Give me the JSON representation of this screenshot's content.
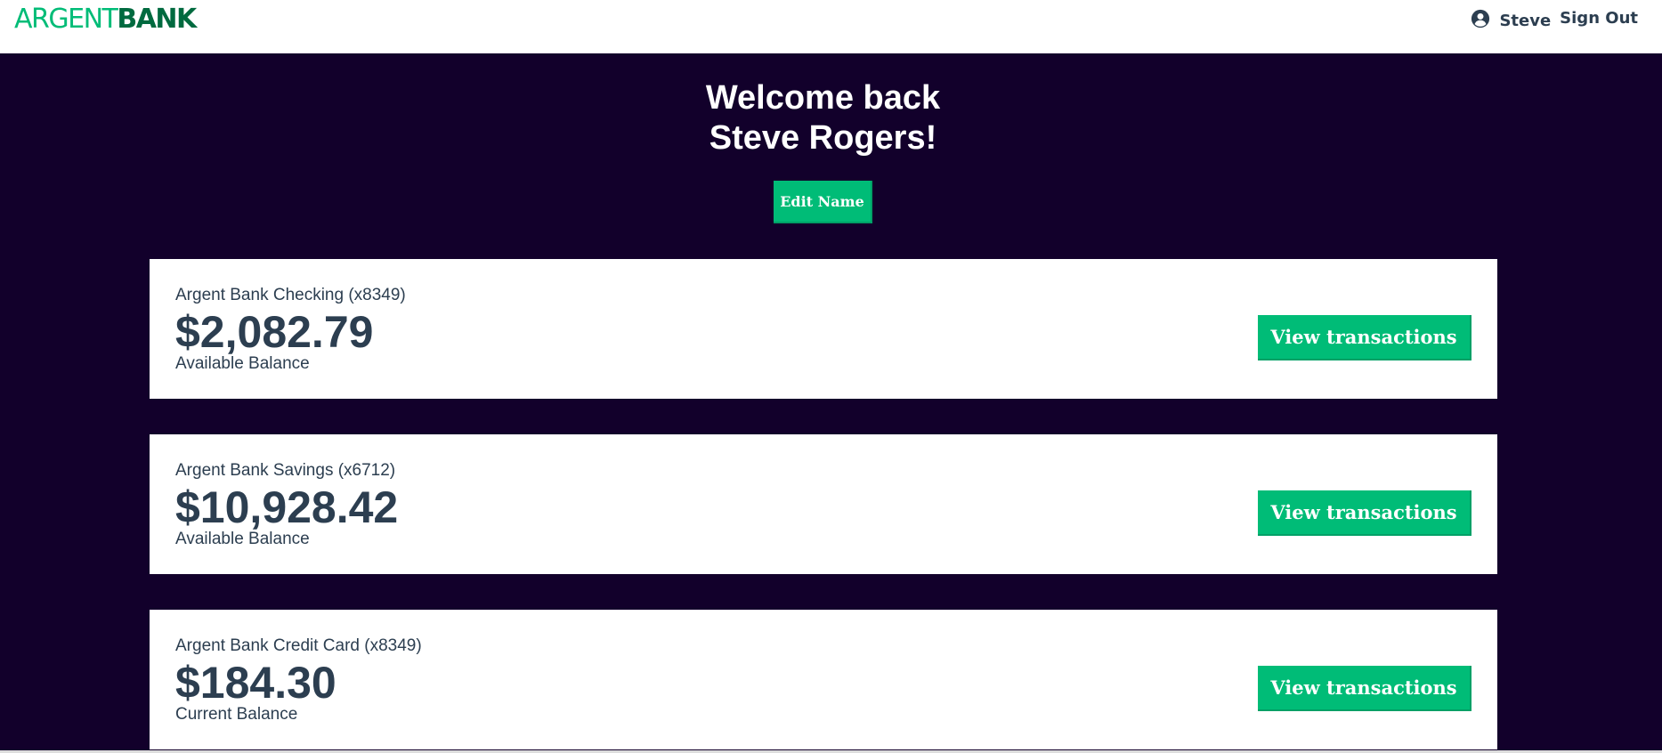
{
  "nav": {
    "logo_part1": "ARGENT",
    "logo_part2": "BANK",
    "user_name": "Steve",
    "sign_out": "Sign Out",
    "user_icon": "user-circle-icon"
  },
  "header": {
    "line1": "Welcome back",
    "line2": "Steve Rogers!",
    "edit_button": "Edit Name"
  },
  "accounts": [
    {
      "title": "Argent Bank Checking (x8349)",
      "amount": "$2,082.79",
      "description": "Available Balance",
      "button": "View transactions"
    },
    {
      "title": "Argent Bank Savings (x6712)",
      "amount": "$10,928.42",
      "description": "Available Balance",
      "button": "View transactions"
    },
    {
      "title": "Argent Bank Credit Card (x8349)",
      "amount": "$184.30",
      "description": "Current Balance",
      "button": "View transactions"
    }
  ],
  "colors": {
    "background": "#12002b",
    "accent": "#00bc77",
    "logo_dark": "#006a3f",
    "text_dark": "#2c3e50"
  }
}
